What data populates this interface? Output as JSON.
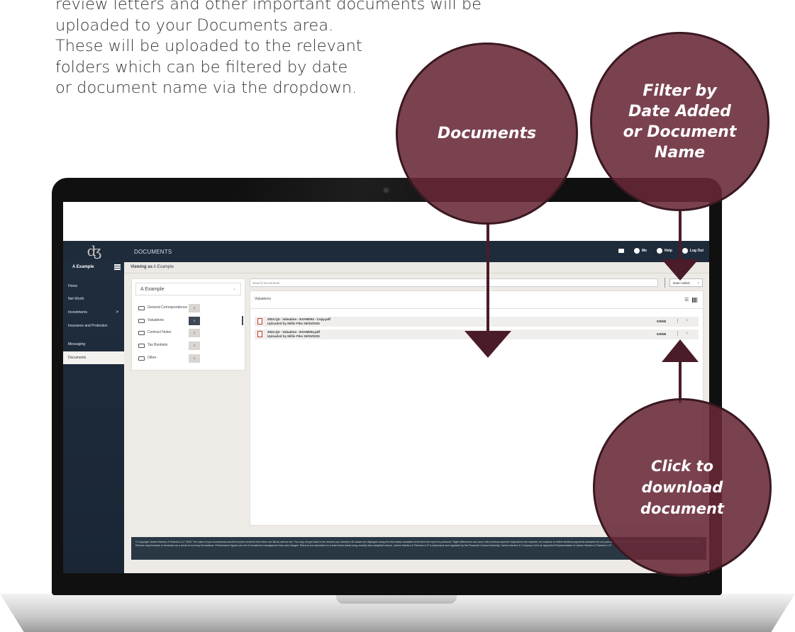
{
  "intro": {
    "lines": [
      "review letters and other important documents will be",
      "uploaded to your Documents area.",
      "These will be uploaded to the relevant",
      "folders which can be filtered by date",
      "or document name via the dropdown."
    ]
  },
  "callouts": {
    "documents": "Documents",
    "filter": [
      "Filter by",
      "Date Added",
      "or Document",
      "Name"
    ],
    "download": [
      "Click to",
      "download",
      "document"
    ]
  },
  "app": {
    "logo": "ʤ",
    "page_heading": "DOCUMENTS",
    "top_actions": {
      "mail_icon": "mail-icon",
      "me": "Me",
      "help": "Help",
      "logout": "Log Out"
    },
    "user_name": "A Example",
    "viewing_prefix": "Viewing as",
    "viewing_name": "A Example",
    "nav": [
      {
        "label": "Home",
        "icon": ""
      },
      {
        "label": "Net Worth",
        "icon": ""
      },
      {
        "label": "Investments",
        "icon": "chevron-right-icon",
        "chevron": ">"
      },
      {
        "label": "Insurance and Protection",
        "icon": ""
      },
      {
        "label": "Messaging",
        "icon": ""
      },
      {
        "label": "Documents",
        "icon": "",
        "active": true
      }
    ],
    "client_select": {
      "value": "A Example",
      "chevron": "⌄"
    },
    "folders": [
      {
        "name": "General Correspondence",
        "count": "0"
      },
      {
        "name": "Valuations",
        "count": "2",
        "active": true
      },
      {
        "name": "Contract Notes",
        "count": "0"
      },
      {
        "name": "Tax Booklets",
        "count": "0"
      },
      {
        "name": "Other",
        "count": "0"
      }
    ],
    "search": {
      "placeholder": "Search Documents"
    },
    "sort": {
      "value": "Date Added",
      "chevron": "⌄"
    },
    "docs_title": "Valuations",
    "view_icons": {
      "list": "☰",
      "grid": "grid-icon"
    },
    "documents": [
      {
        "name": "2024 Q4 - Valuation - EXAM004 - Copy.pdf",
        "uploaded": "Uploaded by Millie Pike 26/03/2025",
        "size": "535kB",
        "more": "⋮",
        "go": ">"
      },
      {
        "name": "2024 Q3 - Valuation - EXAM004.pdf",
        "uploaded": "Uploaded by Millie Pike 26/03/2025",
        "size": "535kB",
        "more": "⋮",
        "go": ">"
      }
    ],
    "footer": "© Copyright James Hambro & Partners LLP 2025. The value of your investments and the income received from them can fall as well as rise. You may not get back to the amount you invested. All values are displayed using the information available at the time the report is produced. Slight differences can occur with previous reports if adjustment are required, for instance to reflect dividend payments declared but not paid at the relevant date. Past performance is not a reliable indicator of future results. Returns may increase or decrease as a result of currency fluctuations. Performance figures are net of investment management fees and charges. Returns are calculated on a total return basis using monthly time-weighted returns. James Hambro & Partners LLP is authorised and regulated by the Financial Conduct Authority. James Hambro & Company Ltd is an Appointed Representative of James Hambro & Partners LLP."
  },
  "colors": {
    "callout_fill": "#682837",
    "navy": "#1d2b3b",
    "arrow": "#4a1c28"
  }
}
